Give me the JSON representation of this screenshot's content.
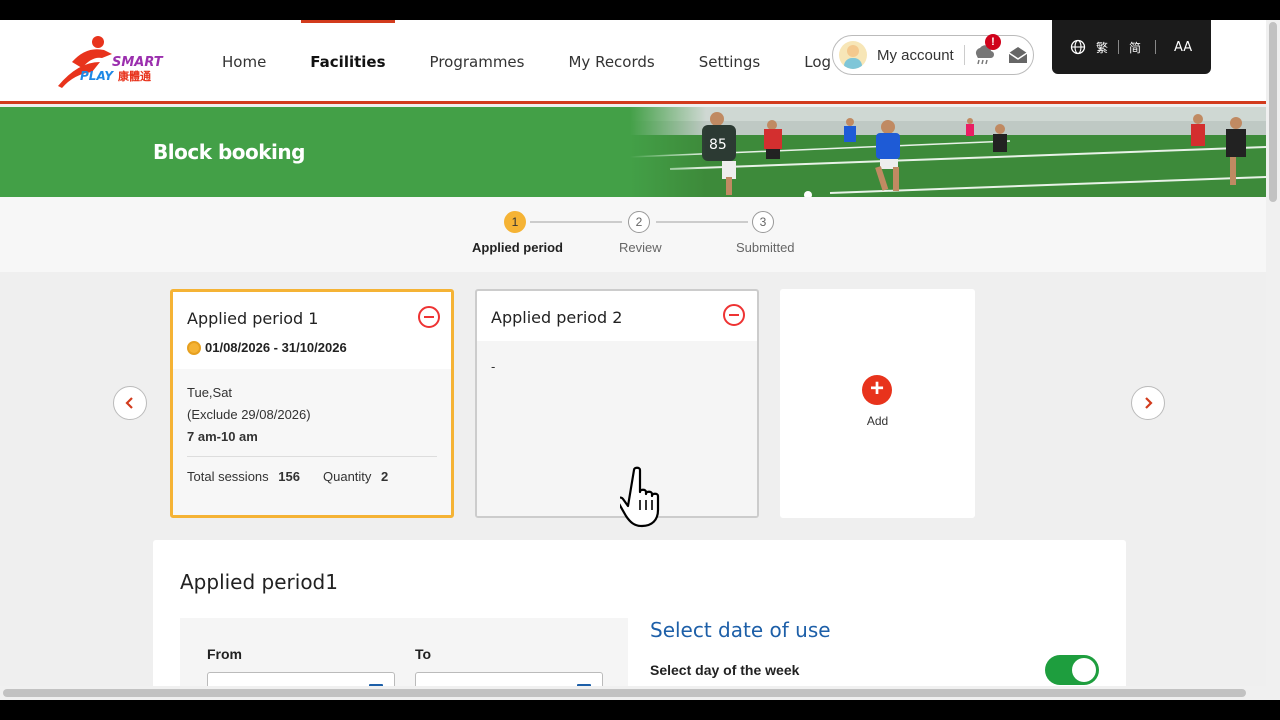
{
  "header": {
    "logo_text_top": "SMART",
    "logo_text_bottom": "PLAY",
    "logo_text_chinese": "康體通",
    "nav": [
      "Home",
      "Facilities",
      "Programmes",
      "My Records",
      "Settings",
      "Log Out"
    ],
    "active_nav": "Facilities",
    "account_label": "My account",
    "notification_badge": "!",
    "lang_traditional": "繁",
    "lang_simplified": "简",
    "font_size_label": "AA"
  },
  "banner": {
    "title": "Block booking"
  },
  "steps": [
    {
      "number": "1",
      "label": "Applied period",
      "active": true
    },
    {
      "number": "2",
      "label": "Review",
      "active": false
    },
    {
      "number": "3",
      "label": "Submitted",
      "active": false
    }
  ],
  "cards": [
    {
      "title": "Applied period 1",
      "date_range": "01/08/2026 - 31/10/2026",
      "days": "Tue,Sat",
      "exclude": "(Exclude 29/08/2026)",
      "time": "7 am-10 am",
      "total_sessions_label": "Total sessions",
      "total_sessions": "156",
      "quantity_label": "Quantity",
      "quantity": "2"
    },
    {
      "title": "Applied period 2",
      "placeholder": "-"
    }
  ],
  "add_card": {
    "label": "Add"
  },
  "detail": {
    "title": "Applied period1",
    "from_label": "From",
    "to_label": "To",
    "select_date_title": "Select date of use",
    "day_of_week_label": "Select day of the week",
    "day_of_week_toggle": true
  },
  "colors": {
    "accent_red": "#d23b1d",
    "banner_green": "#43a047",
    "selected_orange": "#f5b335",
    "toggle_green": "#1e9e3e",
    "title_blue": "#1d5fa8"
  }
}
